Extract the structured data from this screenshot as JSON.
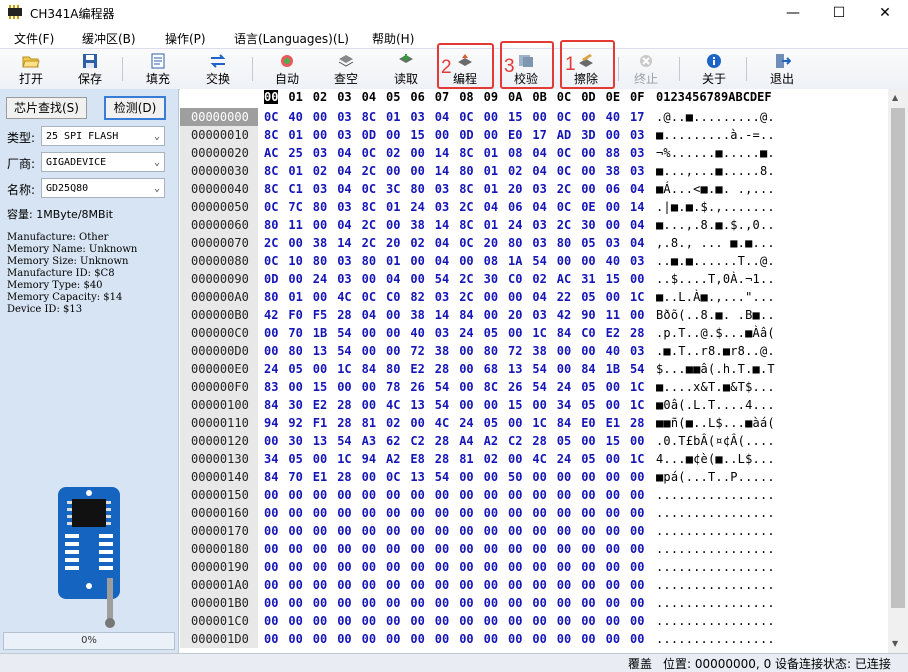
{
  "window": {
    "title": "CH341A编程器",
    "minimize": "—",
    "maximize": "☐",
    "close": "✕"
  },
  "menu": [
    "文件(F)",
    "缓冲区(B)",
    "操作(P)",
    "语言(Languages)(L)",
    "帮助(H)"
  ],
  "toolbar": {
    "buttons": [
      {
        "id": "open",
        "label": "打开",
        "icon": "folder-open-icon"
      },
      {
        "id": "save",
        "label": "保存",
        "icon": "floppy-icon"
      },
      {
        "id": "fill",
        "label": "填充",
        "icon": "fill-icon"
      },
      {
        "id": "swap",
        "label": "交换",
        "icon": "swap-arrows-icon"
      },
      {
        "id": "auto",
        "label": "自动",
        "icon": "auto-icon"
      },
      {
        "id": "blank",
        "label": "查空",
        "icon": "blank-check-icon"
      },
      {
        "id": "read",
        "label": "读取",
        "icon": "read-icon"
      },
      {
        "id": "program",
        "label": "编程",
        "icon": "program-icon"
      },
      {
        "id": "verify",
        "label": "校验",
        "icon": "verify-icon"
      },
      {
        "id": "erase",
        "label": "擦除",
        "icon": "erase-icon"
      },
      {
        "id": "stop",
        "label": "终止",
        "icon": "stop-icon",
        "disabled": true
      },
      {
        "id": "about",
        "label": "关于",
        "icon": "info-icon"
      },
      {
        "id": "exit",
        "label": "退出",
        "icon": "exit-icon"
      }
    ],
    "annotations": [
      {
        "number": "2",
        "target": "program"
      },
      {
        "number": "3",
        "target": "verify"
      },
      {
        "number": "1",
        "target": "erase"
      }
    ],
    "annotation_color": "#e53935"
  },
  "left": {
    "find_chip": "芯片查找(S)",
    "detect": "检测(D)",
    "type_label": "类型:",
    "type_value": "25 SPI FLASH",
    "vendor_label": "厂商:",
    "vendor_value": "GIGADEVICE",
    "name_label": "名称:",
    "name_value": "GD25Q80",
    "capacity": "容量: 1MByte/8MBit",
    "info_lines": [
      "Manufacture: Other",
      "Memory Name: Unknown",
      "Memory Size: Unknown",
      "Manufacture ID: $C8",
      "Memory Type: $40",
      "Memory Capacity: $14",
      "Device ID: $13"
    ],
    "progress": "0%",
    "chip_icon": "soic8-adapter-icon"
  },
  "hex": {
    "columns": [
      "00",
      "01",
      "02",
      "03",
      "04",
      "05",
      "06",
      "07",
      "08",
      "09",
      "0A",
      "0B",
      "0C",
      "0D",
      "0E",
      "0F"
    ],
    "ascii_header": "0123456789ABCDEF",
    "rows": [
      {
        "addr": "00000000",
        "bytes": "0C 40 00 03 8C 01 03 04 0C 00 15 00 0C 00 40 17",
        "ascii": ".@..■.........@."
      },
      {
        "addr": "00000010",
        "bytes": "8C 01 00 03 0D 00 15 00 0D 00 E0 17 AD 3D 00 03",
        "ascii": "■.........à.-=.."
      },
      {
        "addr": "00000020",
        "bytes": "AC 25 03 04 0C 02 00 14 8C 01 08 04 0C 00 88 03",
        "ascii": "¬%......■.....■."
      },
      {
        "addr": "00000030",
        "bytes": "8C 01 02 04 2C 00 00 14 80 01 02 04 0C 00 38 03",
        "ascii": "■...,...■.....8."
      },
      {
        "addr": "00000040",
        "bytes": "8C C1 03 04 0C 3C 80 03 8C 01 20 03 2C 00 06 04",
        "ascii": "■Á...<■.■. .,..."
      },
      {
        "addr": "00000050",
        "bytes": "0C 7C 80 03 8C 01 24 03 2C 04 06 04 0C 0E 00 14",
        "ascii": ".|■.■.$.,......."
      },
      {
        "addr": "00000060",
        "bytes": "80 11 00 04 2C 00 38 14 8C 01 24 03 2C 30 00 04",
        "ascii": "■...,.8.■.$.,0.."
      },
      {
        "addr": "00000070",
        "bytes": "2C 00 38 14 2C 20 02 04 0C 20 80 03 80 05 03 04",
        "ascii": ",.8., ... ■.■..."
      },
      {
        "addr": "00000080",
        "bytes": "0C 10 80 03 80 01 00 04 00 08 1A 54 00 00 40 03",
        "ascii": "..■.■......T..@."
      },
      {
        "addr": "00000090",
        "bytes": "0D 00 24 03 00 04 00 54 2C 30 C0 02 AC 31 15 00",
        "ascii": "..$....T,0À.¬1.."
      },
      {
        "addr": "000000A0",
        "bytes": "80 01 00 4C 0C C0 82 03 2C 00 00 04 22 05 00 1C",
        "ascii": "■..L.À■.,...\"..."
      },
      {
        "addr": "000000B0",
        "bytes": "42 F0 F5 28 04 00 38 14 84 00 20 03 42 90 11 00",
        "ascii": "Bðõ(..8.■. .B■.."
      },
      {
        "addr": "000000C0",
        "bytes": "00 70 1B 54 00 00 40 03 24 05 00 1C 84 C0 E2 28",
        "ascii": ".p.T..@.$...■Àâ("
      },
      {
        "addr": "000000D0",
        "bytes": "00 80 13 54 00 00 72 38 00 80 72 38 00 00 40 03",
        "ascii": ".■.T..r8.■r8..@."
      },
      {
        "addr": "000000E0",
        "bytes": "24 05 00 1C 84 80 E2 28 00 68 13 54 00 84 1B 54",
        "ascii": "$...■■â(.h.T.■.T"
      },
      {
        "addr": "000000F0",
        "bytes": "83 00 15 00 00 78 26 54 00 8C 26 54 24 05 00 1C",
        "ascii": "■....x&T.■&T$..."
      },
      {
        "addr": "00000100",
        "bytes": "84 30 E2 28 00 4C 13 54 00 00 15 00 34 05 00 1C",
        "ascii": "■0â(.L.T....4..."
      },
      {
        "addr": "00000110",
        "bytes": "94 92 F1 28 81 02 00 4C 24 05 00 1C 84 E0 E1 28",
        "ascii": "■■ñ(■..L$...■àá("
      },
      {
        "addr": "00000120",
        "bytes": "00 30 13 54 A3 62 C2 28 A4 A2 C2 28 05 00 15 00",
        "ascii": ".0.T£bÂ(¤¢Â(...."
      },
      {
        "addr": "00000130",
        "bytes": "34 05 00 1C 94 A2 E8 28 81 02 00 4C 24 05 00 1C",
        "ascii": "4...■¢è(■..L$..."
      },
      {
        "addr": "00000140",
        "bytes": "84 70 E1 28 00 0C 13 54 00 00 50 00 00 00 00 00",
        "ascii": "■pá(...T..P....."
      },
      {
        "addr": "00000150",
        "bytes": "00 00 00 00 00 00 00 00 00 00 00 00 00 00 00 00",
        "ascii": "................"
      },
      {
        "addr": "00000160",
        "bytes": "00 00 00 00 00 00 00 00 00 00 00 00 00 00 00 00",
        "ascii": "................"
      },
      {
        "addr": "00000170",
        "bytes": "00 00 00 00 00 00 00 00 00 00 00 00 00 00 00 00",
        "ascii": "................"
      },
      {
        "addr": "00000180",
        "bytes": "00 00 00 00 00 00 00 00 00 00 00 00 00 00 00 00",
        "ascii": "................"
      },
      {
        "addr": "00000190",
        "bytes": "00 00 00 00 00 00 00 00 00 00 00 00 00 00 00 00",
        "ascii": "................"
      },
      {
        "addr": "000001A0",
        "bytes": "00 00 00 00 00 00 00 00 00 00 00 00 00 00 00 00",
        "ascii": "................"
      },
      {
        "addr": "000001B0",
        "bytes": "00 00 00 00 00 00 00 00 00 00 00 00 00 00 00 00",
        "ascii": "................"
      },
      {
        "addr": "000001C0",
        "bytes": "00 00 00 00 00 00 00 00 00 00 00 00 00 00 00 00",
        "ascii": "................"
      },
      {
        "addr": "000001D0",
        "bytes": "00 00 00 00 00 00 00 00 00 00 00 00 00 00 00 00",
        "ascii": "................"
      }
    ]
  },
  "status": {
    "mode": "覆盖",
    "position": "位置: 00000000, 0",
    "connection": "设备连接状态: 已连接"
  }
}
